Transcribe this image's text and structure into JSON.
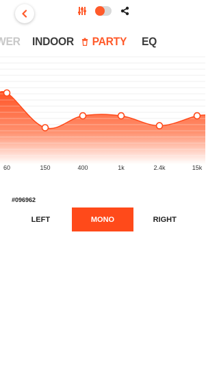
{
  "colors": {
    "accent": "#ff4a1a",
    "accent_light": "#ffd6c8",
    "toggle_track": "#d9d9d9"
  },
  "topbar": {
    "back_icon": "chevron-left-icon",
    "icons": [
      "sliders-icon",
      "toggle-switch",
      "share-icon"
    ],
    "toggle_on": false
  },
  "tabs": [
    {
      "label": "WER",
      "state": "faded"
    },
    {
      "label": "INDOOR",
      "state": "normal"
    },
    {
      "label": "PARTY",
      "state": "active",
      "icon": "trash-icon"
    },
    {
      "label": "EQ",
      "state": "normal"
    }
  ],
  "chart_data": {
    "type": "area",
    "categories": [
      "60",
      "150",
      "400",
      "1k",
      "2.4k",
      "15k"
    ],
    "values": [
      0.65,
      0.3,
      0.42,
      0.42,
      0.32,
      0.42
    ],
    "ylim": [
      0,
      1
    ],
    "grid": true
  },
  "preset": {
    "label": "#096962"
  },
  "channel": {
    "left": "LEFT",
    "mono": "MONO",
    "right": "RIGHT",
    "selected": "MONO"
  }
}
